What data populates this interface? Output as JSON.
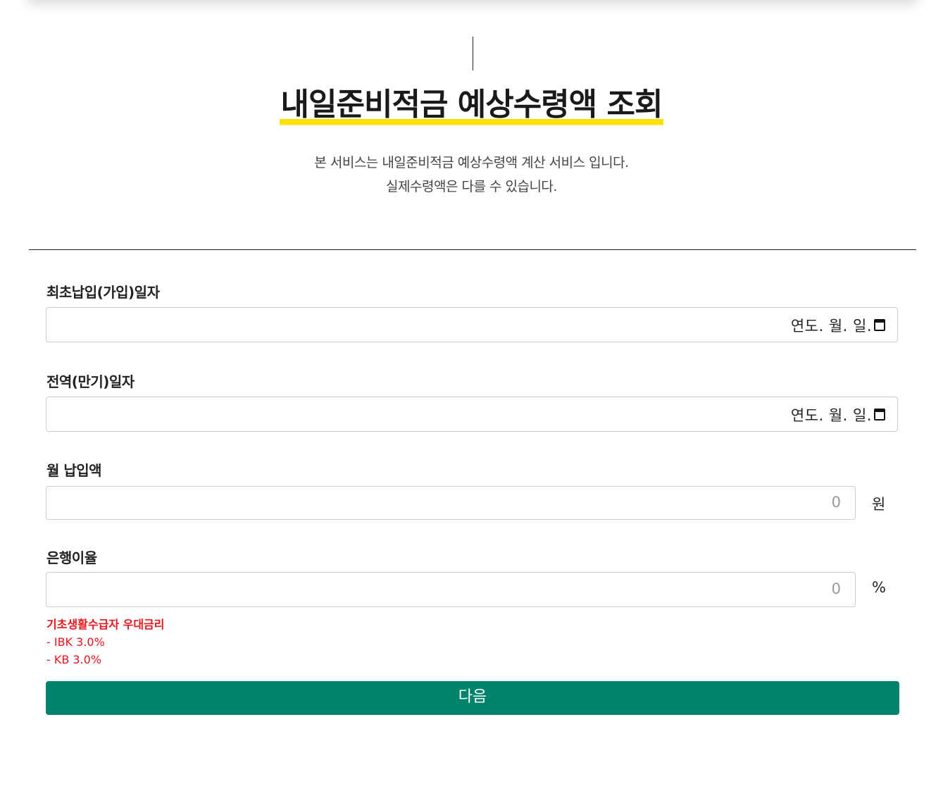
{
  "header": {
    "title": "내일준비적금 예상수령액 조회",
    "description_line1": "본 서비스는 내일준비적금 예상수령액 계산 서비스 입니다.",
    "description_line2": "실제수령액은 다를 수 있습니다.",
    "highlight_color": "#ffe100"
  },
  "form": {
    "first_payment": {
      "label": "최초납입(가입)일자",
      "placeholder": "연도. 월. 일."
    },
    "discharge": {
      "label": "전역(만기)일자",
      "placeholder": "연도. 월. 일."
    },
    "monthly_payment": {
      "label": "월 납입액",
      "placeholder": "0",
      "unit": "원"
    },
    "interest_rate": {
      "label": "은행이율",
      "placeholder": "0",
      "unit": "%"
    },
    "notice": {
      "title": "기초생활수급자 우대금리",
      "items": [
        "- IBK 3.0%",
        "- KB 3.0%"
      ],
      "color": "#e8141b"
    },
    "next_button": {
      "label": "다음",
      "color": "#00836c"
    }
  },
  "icons": {
    "date_picker": "calendar-icon"
  }
}
